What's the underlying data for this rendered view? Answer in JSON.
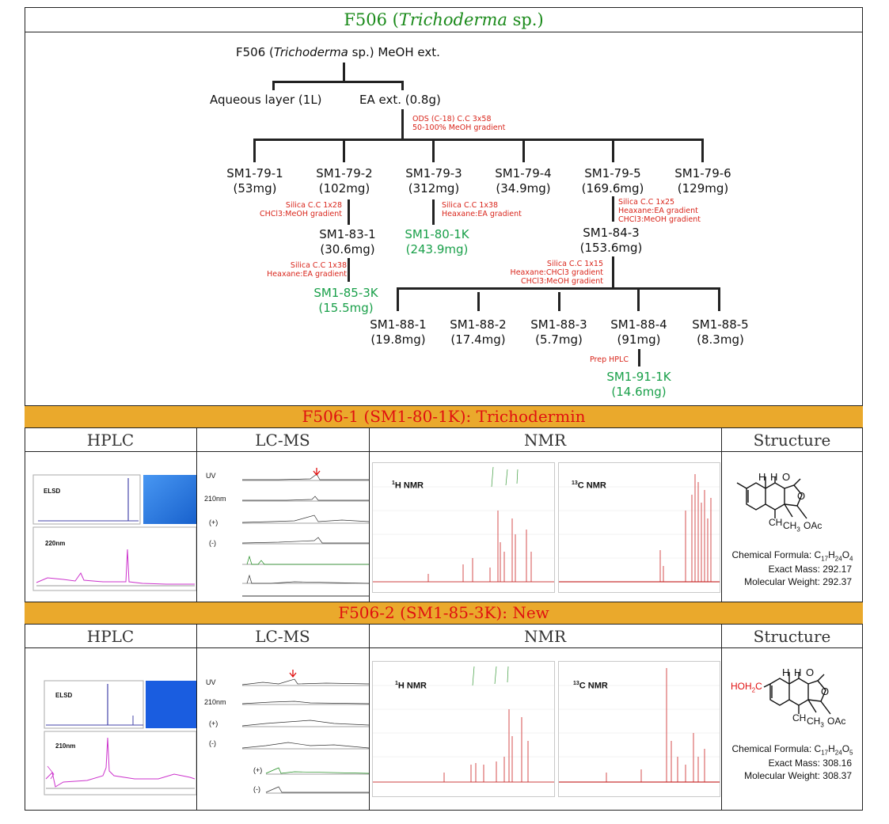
{
  "title": {
    "prefix": "F506 (",
    "genus": "Trichoderma",
    "suffix": " sp.)"
  },
  "scheme": {
    "root": {
      "prefix": "F506 (",
      "genus": "Trichoderma",
      "suffix": " sp.) MeOH ext."
    },
    "aqueous": "Aqueous layer (1L)",
    "ea": "EA ext. (0.8g)",
    "cond_ods": [
      "ODS (C-18) C.C 3x58",
      "50-100% MeOH gradient"
    ],
    "fractions_79": [
      {
        "name": "SM1-79-1",
        "amount": "(53mg)"
      },
      {
        "name": "SM1-79-2",
        "amount": "(102mg)"
      },
      {
        "name": "SM1-79-3",
        "amount": "(312mg)"
      },
      {
        "name": "SM1-79-4",
        "amount": "(34.9mg)"
      },
      {
        "name": "SM1-79-5",
        "amount": "(169.6mg)"
      },
      {
        "name": "SM1-79-6",
        "amount": "(129mg)"
      }
    ],
    "cond_79_2": [
      "Silica C.C 1x28",
      "CHCl3:MeOH gradient"
    ],
    "cond_79_3": [
      "Silica C.C 1x38",
      "Heaxane:EA gradient"
    ],
    "cond_79_5": [
      "Silica C.C 1x25",
      "Heaxane:EA   gradient",
      "CHCl3:MeOH gradient"
    ],
    "sm1_83_1": {
      "name": "SM1-83-1",
      "amount": "(30.6mg)"
    },
    "sm1_80_1k": {
      "name": "SM1-80-1K",
      "amount": "(243.9mg)"
    },
    "sm1_84_3": {
      "name": "SM1-84-3",
      "amount": "(153.6mg)"
    },
    "cond_83_1": [
      "Silica C.C 1x38",
      "Heaxane:EA gradient"
    ],
    "cond_84_3": [
      "Silica C.C 1x15",
      "Heaxane:CHCl3  gradient",
      "CHCl3:MeOH gradient"
    ],
    "sm1_85_3k": {
      "name": "SM1-85-3K",
      "amount": "(15.5mg)"
    },
    "fractions_88": [
      {
        "name": "SM1-88-1",
        "amount": "(19.8mg)"
      },
      {
        "name": "SM1-88-2",
        "amount": "(17.4mg)"
      },
      {
        "name": "SM1-88-3",
        "amount": "(5.7mg)"
      },
      {
        "name": "SM1-88-4",
        "amount": "(91mg)"
      },
      {
        "name": "SM1-88-5",
        "amount": "(8.3mg)"
      }
    ],
    "cond_prep": "Prep HPLC",
    "sm1_91_1k": {
      "name": "SM1-91-1K",
      "amount": "(14.6mg)"
    }
  },
  "columns": {
    "hplc": "HPLC",
    "lcms": "LC-MS",
    "nmr": "NMR",
    "structure": "Structure"
  },
  "compound1": {
    "band": "F506-1 (SM1-80-1K): Trichodermin",
    "hplc_labels": {
      "elsd": "ELSD",
      "uv": "220nm"
    },
    "lcms_rows": [
      "UV",
      "210nm",
      "(+)",
      "(-)"
    ],
    "nmr_h": "H NMR",
    "nmr_h_sup": "1",
    "nmr_c": "C NMR",
    "nmr_c_sup": "13",
    "struct": {
      "h1": "H",
      "h2": "H",
      "o1": "O",
      "o2": "O",
      "ch": "CH",
      "ch3": "CH",
      "sub3": "3",
      "oac": "OAc"
    },
    "formula": {
      "label": "Chemical Formula: ",
      "c": "C",
      "c_n": "17",
      "h": "H",
      "h_n": "24",
      "o": "O",
      "o_n": "4"
    },
    "exact_mass": "Exact Mass: 292.17",
    "mol_weight": "Molecular Weight: 292.37"
  },
  "compound2": {
    "band": "F506-2 (SM1-85-3K): New",
    "hplc_labels": {
      "elsd": "ELSD",
      "uv": "210nm"
    },
    "lcms_rows": [
      "UV",
      "210nm",
      "(+)",
      "(-)",
      "(+)",
      "(-)"
    ],
    "nmr_h": "H NMR",
    "nmr_h_sup": "1",
    "nmr_c": "C NMR",
    "nmr_c_sup": "13",
    "struct": {
      "hoh2c": "HOH",
      "hoh2c_sub": "2",
      "hoh2c_c": "C",
      "h1": "H",
      "h2": "H",
      "o1": "O",
      "o2": "O",
      "ch": "CH",
      "ch3": "CH",
      "sub3": "3",
      "oac": "OAc"
    },
    "formula": {
      "label": "Chemical Formula: ",
      "c": "C",
      "c_n": "17",
      "h": "H",
      "h_n": "24",
      "o": "O",
      "o_n": "5"
    },
    "exact_mass": "Exact Mass: 308.16",
    "mol_weight": "Molecular Weight: 308.37"
  },
  "colors": {
    "green": "#1aa04a",
    "red": "#d9261c",
    "band": "#eaa92c",
    "band_text": "#e01010"
  }
}
